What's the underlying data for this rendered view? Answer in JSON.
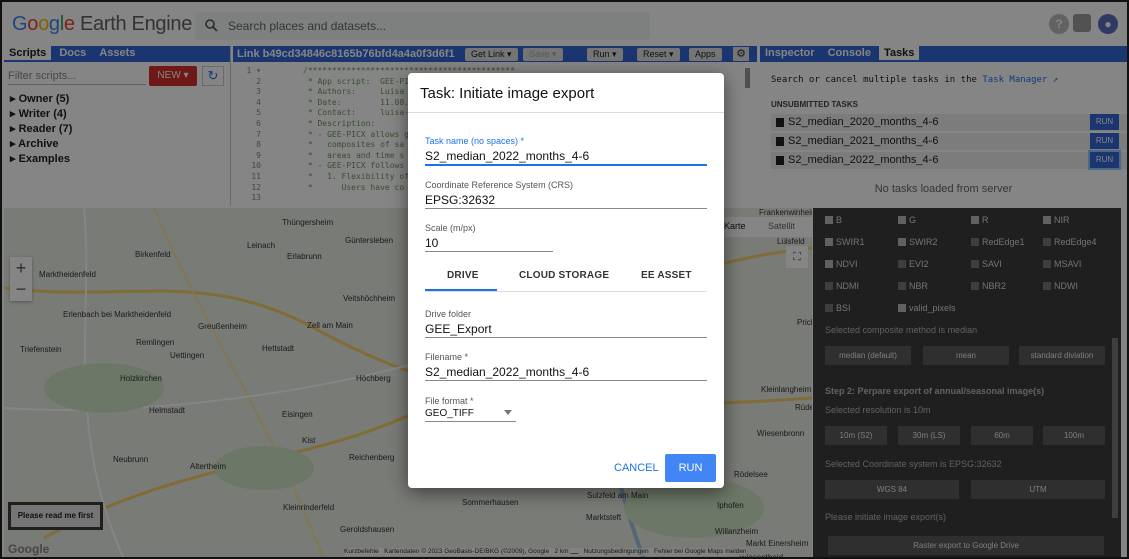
{
  "app": {
    "logo": "Google Earth Engine",
    "search_placeholder": "Search places and datasets..."
  },
  "left_panel": {
    "tabs": [
      "Scripts",
      "Docs",
      "Assets"
    ],
    "filter_placeholder": "Filter scripts...",
    "new_label": "NEW",
    "tree": [
      "Owner (5)",
      "Writer (4)",
      "Reader (7)",
      "Archive",
      "Examples"
    ]
  },
  "editor": {
    "link": "Link b49cd34846c8165b76bfd4a4a0f3d6f1",
    "buttons": [
      "Get Link",
      "Save",
      "Run",
      "Reset",
      "Apps"
    ],
    "line_numbers": "1 ▾\n2\n3\n4\n5\n6\n7\n8\n9\n10\n11\n12\n13",
    "code": "/*******************************************\n * App script:  GEE-PICX\n * Authors:     Luisa\n * Date:        11.08.\n * Contact:     luisa-\n * Description:\n * - GEE-PICX allows g\n *   composites of sa\n *   areas and time s\n * - GEE-PICX follows\n *   1. Flexibility of\n *      Users have co\n"
  },
  "right_panel": {
    "tabs": [
      "Inspector",
      "Console",
      "Tasks"
    ],
    "hint_text": "Search or cancel multiple tasks in the",
    "hint_link": "Task Manager",
    "section": "UNSUBMITTED TASKS",
    "tasks": [
      "S2_median_2020_months_4-6",
      "S2_median_2021_months_4-6",
      "S2_median_2022_months_4-6"
    ],
    "run_label": "RUN",
    "empty": "No tasks loaded from server"
  },
  "map": {
    "towns": [
      "Thüngersheim",
      "Güntersleben",
      "Leinach",
      "Erlabrunn",
      "Birkenfeld",
      "Marktheidenfeld",
      "Erlenbach bei Marktheidenfeld",
      "Greußenheim",
      "Zell am Main",
      "Veitshöchheim",
      "Remlingen",
      "Uettingen",
      "Hettstadt",
      "Triefenstein",
      "Holzkirchen",
      "Höchberg",
      "Helmstadt",
      "Eisingen",
      "Kist",
      "Neubrunn",
      "Altertheim",
      "Reichenberg",
      "Kleinrinderfeld",
      "Geroldshausen",
      "Sommerhausen",
      "Marktsteft",
      "Kleinlangheim",
      "Wiesenbronn",
      "Iphofen",
      "Willanzheim",
      "Rüdenhausen",
      "Frankenwinheim",
      "Lülsfeld",
      "Prichsenstadt",
      "Wiesentheid",
      "Markt Einersheim",
      "Sulzfeld am Main",
      "Rödelsee"
    ],
    "zoom_in": "+",
    "zoom_out": "−",
    "map_btns": [
      "Karte",
      "Satellit"
    ],
    "readme": "Please read me first",
    "attribution": "Kurzbefehle   Kartendaten © 2023 GeoBasis-DE/BKG (©2009), Google   2 km ⎵⎵⎵   Nutzungsbedingungen   Fehler bei Google Maps melden",
    "google": "Google"
  },
  "settings_panel": {
    "bands": [
      [
        {
          "l": "B",
          "on": true
        },
        {
          "l": "G",
          "on": true
        },
        {
          "l": "R",
          "on": true
        },
        {
          "l": "NIR",
          "on": true
        }
      ],
      [
        {
          "l": "SWIR1",
          "on": true
        },
        {
          "l": "SWIR2",
          "on": true
        },
        {
          "l": "RedEdge1",
          "on": false
        },
        {
          "l": "RedEdge4",
          "on": false
        }
      ],
      [
        {
          "l": "NDVI",
          "on": true
        },
        {
          "l": "EVI2",
          "on": false
        },
        {
          "l": "SAVI",
          "on": false
        },
        {
          "l": "MSAVI",
          "on": false
        }
      ],
      [
        {
          "l": "NDMI",
          "on": false
        },
        {
          "l": "NBR",
          "on": false
        },
        {
          "l": "NBR2",
          "on": false
        },
        {
          "l": "NDWI",
          "on": false
        }
      ],
      [
        {
          "l": "BSI",
          "on": false
        },
        {
          "l": "valid_pixels",
          "on": true
        }
      ]
    ],
    "composite_text": "Selected composite method is median",
    "composite_btns": [
      "median (default)",
      "mean",
      "standard diviation"
    ],
    "step2": "Step 2: Perpare export of annual/seasonal image(s)",
    "resolution_text": "Selected resolution is 10m",
    "res_btns": [
      "10m (S2)",
      "30m (LS)",
      "60m",
      "100m"
    ],
    "crs_text": "Selected Coordinate system is EPSG:32632",
    "crs_btns": [
      "WGS 84",
      "UTM"
    ],
    "initiate_text": "Please initiate image export(s)",
    "raster_btn": "Raster export to Google Drive"
  },
  "dialog": {
    "title": "Task: Initiate image export",
    "task_name_label": "Task name (no spaces) *",
    "task_name_value": "S2_median_2022_months_4-6",
    "crs_label": "Coordinate Reference System (CRS)",
    "crs_value": "EPSG:32632",
    "scale_label": "Scale (m/px)",
    "scale_value": "10",
    "tabs": [
      "DRIVE",
      "CLOUD STORAGE",
      "EE ASSET"
    ],
    "folder_label": "Drive folder",
    "folder_value": "GEE_Export",
    "filename_label": "Filename *",
    "filename_value": "S2_median_2022_months_4-6",
    "format_label": "File format *",
    "format_value": "GEO_TIFF",
    "cancel": "CANCEL",
    "run": "RUN"
  }
}
